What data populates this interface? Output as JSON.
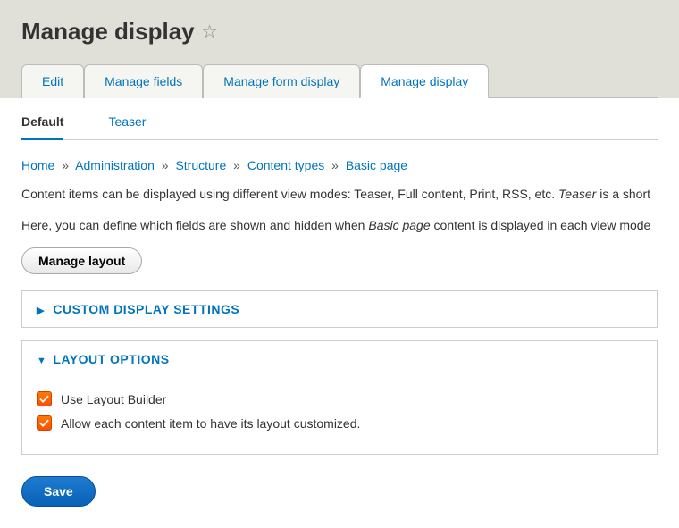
{
  "header": {
    "title": "Manage display"
  },
  "primary_tabs": {
    "items": [
      {
        "label": "Edit"
      },
      {
        "label": "Manage fields"
      },
      {
        "label": "Manage form display"
      },
      {
        "label": "Manage display"
      }
    ]
  },
  "secondary_tabs": {
    "items": [
      {
        "label": "Default"
      },
      {
        "label": "Teaser"
      }
    ]
  },
  "breadcrumbs": {
    "items": [
      "Home",
      "Administration",
      "Structure",
      "Content types",
      "Basic page"
    ]
  },
  "descriptions": {
    "line1_a": "Content items can be displayed using different view modes: Teaser, Full content, Print, RSS, etc. ",
    "line1_em": "Teaser",
    "line1_b": " is a short ",
    "line2_a": "Here, you can define which fields are shown and hidden when ",
    "line2_em": "Basic page",
    "line2_b": " content is displayed in each view mode"
  },
  "buttons": {
    "manage_layout": "Manage layout",
    "save": "Save"
  },
  "details": {
    "custom_display": {
      "title": "CUSTOM DISPLAY SETTINGS"
    },
    "layout_options": {
      "title": "LAYOUT OPTIONS",
      "use_layout_builder": "Use Layout Builder",
      "allow_custom": "Allow each content item to have its layout customized."
    }
  }
}
